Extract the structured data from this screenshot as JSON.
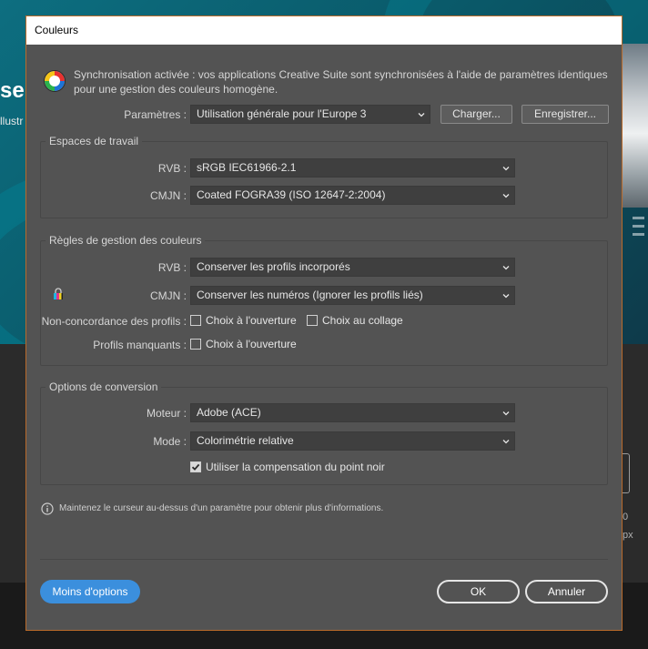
{
  "background": {
    "banner_title_fragment": "ser",
    "banner_subtitle_fragment": "llustr",
    "side_value": "0",
    "side_unit": "px"
  },
  "dialog": {
    "title": "Couleurs",
    "sync_message": "Synchronisation activée : vos applications Creative Suite sont synchronisées à l'aide de paramètres identiques pour une gestion des couleurs homogène.",
    "settings": {
      "label": "Paramètres :",
      "value": "Utilisation générale pour l'Europe 3",
      "load_button": "Charger...",
      "save_button": "Enregistrer..."
    },
    "working_spaces": {
      "title": "Espaces de travail",
      "rgb_label": "RVB :",
      "rgb_value": "sRGB IEC61966-2.1",
      "cmyk_label": "CMJN :",
      "cmyk_value": "Coated FOGRA39 (ISO 12647-2:2004)"
    },
    "policies": {
      "title": "Règles de gestion des couleurs",
      "rgb_label": "RVB :",
      "rgb_value": "Conserver les profils incorporés",
      "cmyk_label": "CMJN :",
      "cmyk_value": "Conserver les numéros (Ignorer les profils liés)",
      "mismatch_label": "Non-concordance des profils :",
      "mismatch_open": "Choix à l'ouverture",
      "mismatch_paste": "Choix au collage",
      "missing_label": "Profils manquants :",
      "missing_open": "Choix à l'ouverture"
    },
    "conversion": {
      "title": "Options de conversion",
      "engine_label": "Moteur :",
      "engine_value": "Adobe (ACE)",
      "intent_label": "Mode :",
      "intent_value": "Colorimétrie relative",
      "bpc_label": "Utiliser la compensation du point noir",
      "bpc_checked": true
    },
    "info_text": "Maintenez le curseur au-dessus d'un paramètre pour obtenir plus d'informations.",
    "fewer_options_button": "Moins d'options",
    "ok_button": "OK",
    "cancel_button": "Annuler"
  }
}
